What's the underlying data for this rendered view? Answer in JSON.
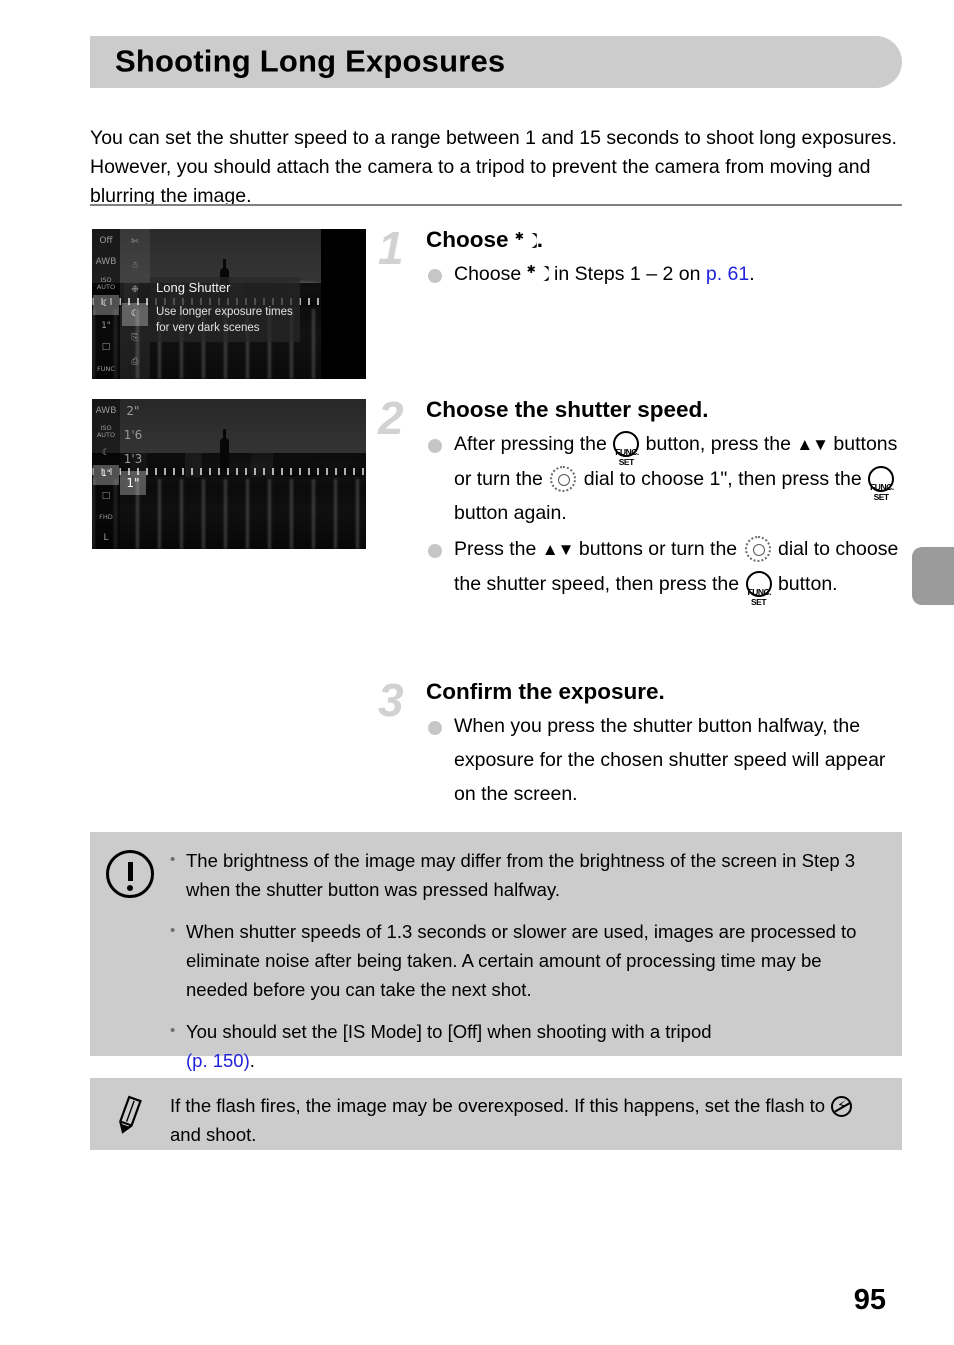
{
  "header": {
    "title": "Shooting Long Exposures"
  },
  "intro": "You can set the shutter speed to a range between 1 and 15 seconds to shoot long exposures. However, you should attach the camera to a tripod to prevent the camera from moving and blurring the image.",
  "screenshots": {
    "shot1": {
      "left_column_icons": [
        "Off",
        "AWB",
        "ISO AUTO",
        "night-scene",
        "1\"",
        "single-frame",
        "FUNC"
      ],
      "mid_column_icons": [
        "scissors",
        "snowman",
        "fireworks",
        "night-scene",
        "stitch-assist-1",
        "stitch-assist-2"
      ],
      "selected_mid_index": 3,
      "selected_left_index": 3,
      "menu_title": "Long Shutter",
      "menu_desc_line1": "Use longer exposure times",
      "menu_desc_line2": "for very dark scenes"
    },
    "shot2": {
      "left_column_icons": [
        "AWB",
        "ISO AUTO",
        "night-scene",
        "1\"",
        "single-frame",
        "FHD",
        "L"
      ],
      "selected_left_index": 3,
      "shutter_values": [
        "2\"",
        "1'6",
        "1'3",
        "1\""
      ],
      "selected_value_index": 3
    }
  },
  "steps": [
    {
      "number": "1",
      "heading_pre": "Choose ",
      "heading_post": ".",
      "bullets": [
        {
          "pre": "Choose ",
          "mid": " in Steps 1 – 2 on ",
          "link": "p. 61",
          "post": "."
        }
      ]
    },
    {
      "number": "2",
      "heading": "Choose the shutter speed.",
      "bullets": [
        {
          "p1": "After pressing the ",
          "p2": " button, press the ",
          "p3": " buttons or turn the ",
          "p4": " dial to choose ",
          "p5": "1\"",
          "p6": ", then press the ",
          "p7": " button again."
        },
        {
          "p1": "Press the ",
          "p2": " buttons or turn the ",
          "p3": " dial to choose the shutter speed, then press the ",
          "p4": " button."
        }
      ]
    },
    {
      "number": "3",
      "heading": "Confirm the exposure.",
      "bullets": [
        {
          "text": "When you press the shutter button halfway, the exposure for the chosen shutter speed will appear on the screen."
        }
      ]
    }
  ],
  "warning_box": {
    "icon": "exclamation-circle-icon",
    "items": [
      "The brightness of the image may differ from the brightness of the screen in Step 3 when the shutter button was pressed halfway.",
      "When shutter speeds of 1.3 seconds or slower are used, images are processed to eliminate noise after being taken. A certain amount of processing time may be needed before you can take the next shot.",
      "You should set the [IS Mode] to [Off] when shooting with a tripod "
    ],
    "link": "(p. 150)",
    "link_suffix": "."
  },
  "note_box": {
    "icon": "pencil-icon",
    "pre": "If the flash fires, the image may be overexposed. If this happens, set the flash to ",
    "post": " and shoot."
  },
  "page_number": "95",
  "colors": {
    "header_bg": "#cccccc",
    "box_bg": "#cccccc",
    "link": "#2222dd",
    "step_number": "#d2d2d2",
    "bullet_dot": "#c6c6c6",
    "edge_tab": "#9b9b9b",
    "rule": "#808080"
  }
}
